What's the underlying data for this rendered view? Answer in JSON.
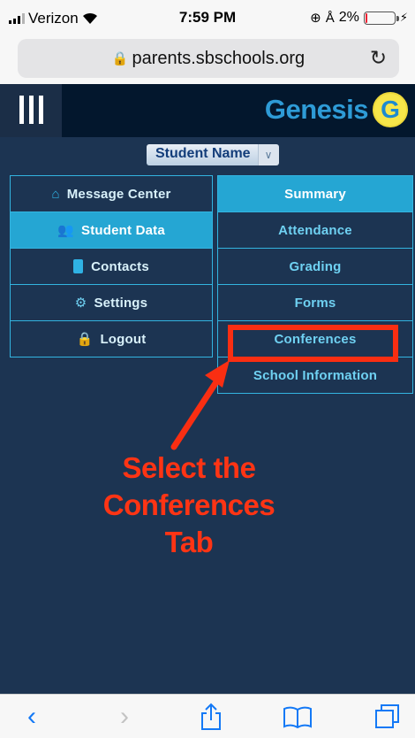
{
  "status_bar": {
    "carrier": "Verizon",
    "time": "7:59 PM",
    "battery_percent": "2%",
    "battery_level": 0.02
  },
  "browser": {
    "url": "parents.sbschools.org"
  },
  "app": {
    "brand": "Genesis",
    "logo_letter": "G"
  },
  "student_selector": {
    "selected": "Student Name"
  },
  "menu_left": [
    {
      "label": "Message Center",
      "icon": "home-icon",
      "active": false
    },
    {
      "label": "Student Data",
      "icon": "users-icon",
      "active": true
    },
    {
      "label": "Contacts",
      "icon": "book-icon",
      "active": false
    },
    {
      "label": "Settings",
      "icon": "gear-icon",
      "active": false
    },
    {
      "label": "Logout",
      "icon": "lock-icon",
      "active": false
    }
  ],
  "menu_right": [
    {
      "label": "Summary",
      "active": true
    },
    {
      "label": "Attendance",
      "active": false
    },
    {
      "label": "Grading",
      "active": false
    },
    {
      "label": "Forms",
      "active": false
    },
    {
      "label": "Conferences",
      "active": false
    },
    {
      "label": "School Information",
      "active": false
    }
  ],
  "annotation": {
    "line1": "Select the",
    "line2": "Conferences Tab",
    "color": "#f92e12"
  },
  "colors": {
    "page_bg": "#1c3452",
    "header_bg": "#03172d",
    "accent": "#25a6d3",
    "border": "#33b4e0",
    "brand_blue": "#2e9bd6",
    "logo_yellow": "#f7e64a",
    "ios_blue": "#1479f6"
  }
}
